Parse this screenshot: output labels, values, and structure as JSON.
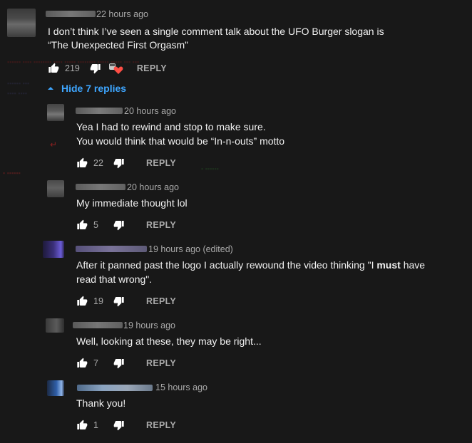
{
  "top_comment": {
    "time": "22 hours ago",
    "lines": [
      "I don’t think I’ve seen a single comment talk about the UFO Burger slogan is",
      "“The Unexpected First Orgasm”"
    ],
    "likes": "219",
    "reply_label": "REPLY"
  },
  "hide_replies_label": "Hide 7 replies",
  "replies": [
    {
      "time": "20 hours ago",
      "lines": [
        "Yea I had to rewind and stop to make sure.",
        " You would think that would be “In-n-outs” motto"
      ],
      "likes": "22",
      "reply_label": "REPLY"
    },
    {
      "time": "20 hours ago",
      "lines": [
        "My immediate thought lol"
      ],
      "likes": "5",
      "reply_label": "REPLY"
    },
    {
      "time": "19 hours ago (edited)",
      "line1_before": "After it panned past the logo I actually rewound the video thinking \"I ",
      "line1_bold": "must",
      "line1_after": " have",
      "line2": "read that wrong\".",
      "likes": "19",
      "reply_label": "REPLY"
    },
    {
      "time": "19 hours ago",
      "lines": [
        "Well, looking at these, they may be right..."
      ],
      "likes": "7",
      "reply_label": "REPLY"
    },
    {
      "time": "15 hours ago",
      "lines": [
        "Thank you!"
      ],
      "likes": "1",
      "reply_label": "REPLY"
    }
  ],
  "colors": {
    "background": "#181818",
    "text": "#f1f1f1",
    "meta": "#aaaaaa",
    "link": "#3ea6ff",
    "heart": "#ff4e45"
  },
  "icons": {
    "like": "thumbs-up-icon",
    "dislike": "thumbs-down-icon",
    "collapse": "caret-up-icon",
    "creator_heart": "creator-heart-icon"
  }
}
